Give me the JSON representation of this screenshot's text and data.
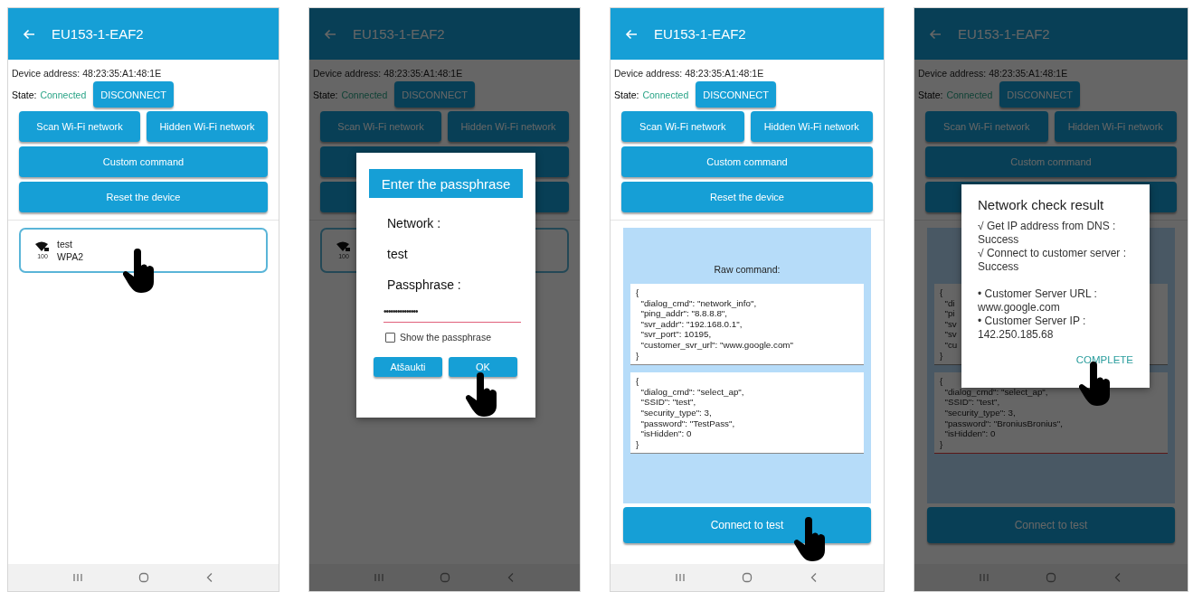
{
  "screens": [
    {
      "dimmed": false,
      "app_bar": {
        "title": "EU153-1-EAF2"
      },
      "device_address": "Device address: 48:23:35:A1:48:1E",
      "state_label": "State:",
      "state_value": "Connected",
      "disconnect": "DISCONNECT",
      "buttons": [
        {
          "kind": "half",
          "label": "Scan Wi-Fi network"
        },
        {
          "kind": "half",
          "label": "Hidden Wi-Fi network"
        },
        {
          "kind": "full",
          "label": "Custom command"
        },
        {
          "kind": "full",
          "label": "Reset the device"
        }
      ],
      "networks": [
        {
          "signal": "100",
          "ssid": "test",
          "security": "WPA2",
          "touched": true
        }
      ]
    },
    {
      "dimmed": true,
      "app_bar": {
        "title": "EU153-1-EAF2"
      },
      "device_address": "Device address: 48:23:35:A1:48:1E",
      "state_label": "State:",
      "state_value": "Connected",
      "disconnect": "DISCONNECT",
      "buttons": [
        {
          "kind": "half",
          "label": "Scan Wi-Fi network"
        },
        {
          "kind": "half",
          "label": "Hidden Wi-Fi network"
        },
        {
          "kind": "full"
        },
        {
          "kind": "full"
        }
      ],
      "networks": [
        {
          "signal": "100",
          "touched": false
        }
      ],
      "dialog": {
        "kind": "passphrase",
        "title": "Enter the passphrase",
        "network_label": "Network :",
        "network": "test",
        "passphrase_label": "Passphrase :",
        "passphrase": "•••••••••••••••",
        "show_passphrase": {
          "label": "Show the passphrase",
          "checked": false
        },
        "cancel": "Atšaukti",
        "ok": "OK",
        "touched": true
      }
    },
    {
      "dimmed": false,
      "app_bar": {
        "title": "EU153-1-EAF2"
      },
      "device_address": "Device address: 48:23:35:A1:48:1E",
      "state_label": "State:",
      "state_value": "Connected",
      "disconnect": "DISCONNECT",
      "buttons": [
        {
          "kind": "half",
          "label": "Scan Wi-Fi network"
        },
        {
          "kind": "half",
          "label": "Hidden Wi-Fi network"
        },
        {
          "kind": "full",
          "label": "Custom command"
        },
        {
          "kind": "full",
          "label": "Reset the device"
        }
      ],
      "raw_command": {
        "label": "Raw command:",
        "blocks": [
          {
            "focused": false,
            "lines": [
              "{",
              "  \"dialog_cmd\": \"network_info\",",
              "  \"ping_addr\": \"8.8.8.8\",",
              "  \"svr_addr\": \"192.168.0.1\",",
              "  \"svr_port\": 10195,",
              "  \"customer_svr_url\": \"www.google.com\"",
              "}"
            ]
          },
          {
            "focused": false,
            "lines": [
              "{",
              "  \"dialog_cmd\": \"select_ap\",",
              "  \"SSID\": \"test\",",
              "  \"security_type\": 3,",
              "  \"password\": \"TestPass\",",
              "  \"isHidden\": 0",
              "}"
            ]
          }
        ],
        "button": "Connect to test",
        "touched": true
      }
    },
    {
      "dimmed": true,
      "app_bar": {
        "title": "EU153-1-EAF2"
      },
      "device_address": "Device address: 48:23:35:A1:48:1E",
      "state_label": "State:",
      "state_value": "Connected",
      "disconnect": "DISCONNECT",
      "buttons": [
        {
          "kind": "half",
          "label": "Scan Wi-Fi network"
        },
        {
          "kind": "half",
          "label": "Hidden Wi-Fi network"
        },
        {
          "kind": "full",
          "label": "Custom command"
        },
        {
          "kind": "full"
        }
      ],
      "raw_command": {
        "blocks": [
          {
            "focused": false,
            "lines": [
              "{",
              "  \"di",
              "  \"pi",
              "  \"sv",
              "  \"sv",
              "  \"cu",
              "}"
            ]
          },
          {
            "focused": true,
            "lines": [
              "{",
              "  \"dialog_cmd\": \"select_ap\",",
              "  \"SSID\": \"test\",",
              "  \"security_type\": 3,",
              "  \"password\": \"BroniusBronius\",",
              "  \"isHidden\": 0",
              "}"
            ]
          }
        ],
        "button": "Connect to test",
        "touched": false
      },
      "dialog": {
        "kind": "result",
        "title": "Network check result",
        "checks": [
          {
            "label": "√ Get IP address from DNS :",
            "value": "Success"
          },
          {
            "label": "√ Connect to customer server :",
            "value": "Success"
          }
        ],
        "details": [
          {
            "label": "• Customer Server URL :",
            "value": "www.google.com"
          },
          {
            "label": "• Customer Server IP :",
            "value": "142.250.185.68"
          }
        ],
        "complete": "COMPLETE",
        "touched": true
      }
    }
  ]
}
